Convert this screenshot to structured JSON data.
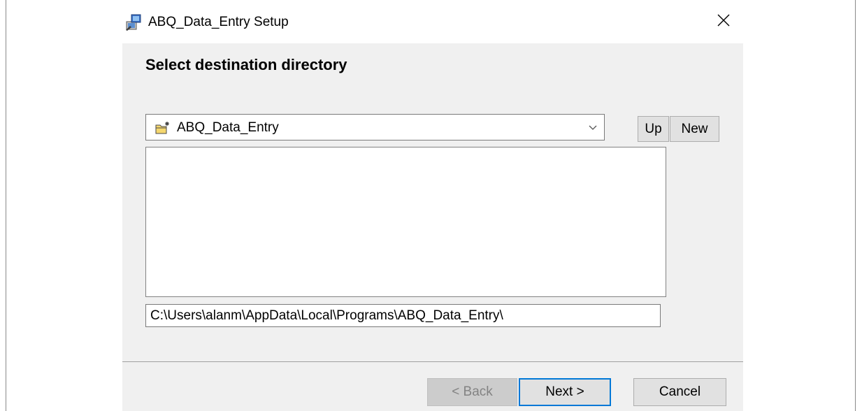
{
  "window": {
    "title": "ABQ_Data_Entry Setup",
    "icon": "installer-icon",
    "close_icon": "close-icon"
  },
  "main": {
    "heading": "Select destination directory",
    "combo": {
      "icon": "new-folder-icon",
      "selected": "ABQ_Data_Entry",
      "arrow_icon": "chevron-down-icon"
    },
    "up_label": "Up",
    "new_label": "New",
    "folder_list": [],
    "path_value": "C:\\Users\\alanm\\AppData\\Local\\Programs\\ABQ_Data_Entry\\"
  },
  "footer": {
    "back_label": "< Back",
    "next_label": "Next >",
    "cancel_label": "Cancel"
  },
  "colors": {
    "window_bg": "#f0f0f0",
    "titlebar_bg": "#ffffff",
    "focus_border": "#0078d7",
    "disabled_text": "#838383"
  }
}
